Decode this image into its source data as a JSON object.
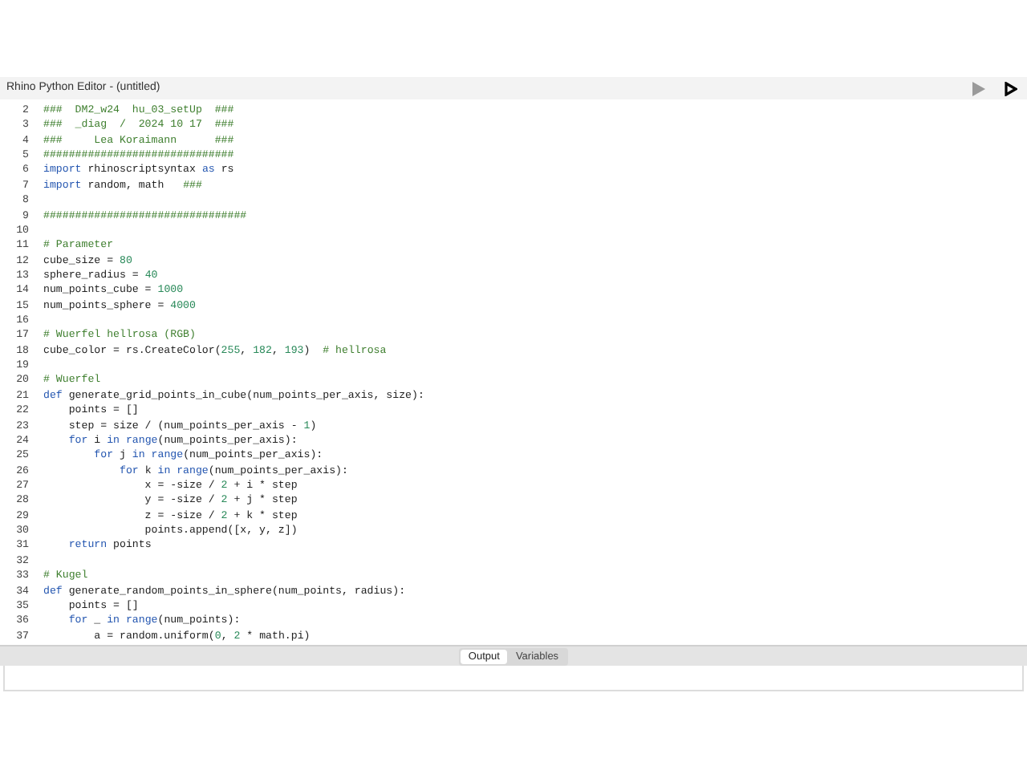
{
  "window": {
    "title": "Rhino Python Editor - (untitled)"
  },
  "editor": {
    "lines": [
      {
        "number": "2",
        "tokens": [
          {
            "kind": "comment",
            "text": "###  DM2_w24  hu_03_setUp  ###"
          }
        ]
      },
      {
        "number": "3",
        "tokens": [
          {
            "kind": "comment",
            "text": "###  _diag  /  2024 10 17  ###"
          }
        ]
      },
      {
        "number": "4",
        "tokens": [
          {
            "kind": "comment",
            "text": "###     Lea Koraimann      ###"
          }
        ]
      },
      {
        "number": "5",
        "tokens": [
          {
            "kind": "comment",
            "text": "##############################"
          }
        ]
      },
      {
        "number": "6",
        "tokens": [
          {
            "kind": "keyword",
            "text": "import"
          },
          {
            "kind": "plain",
            "text": " rhinoscriptsyntax "
          },
          {
            "kind": "keyword",
            "text": "as"
          },
          {
            "kind": "plain",
            "text": " rs"
          }
        ]
      },
      {
        "number": "7",
        "tokens": [
          {
            "kind": "keyword",
            "text": "import"
          },
          {
            "kind": "plain",
            "text": " random, math   "
          },
          {
            "kind": "comment",
            "text": "###"
          }
        ]
      },
      {
        "number": "8"
      },
      {
        "number": "9",
        "tokens": [
          {
            "kind": "comment",
            "text": "################################"
          }
        ]
      },
      {
        "number": "10"
      },
      {
        "number": "11",
        "tokens": [
          {
            "kind": "comment",
            "text": "# Parameter"
          }
        ]
      },
      {
        "number": "12",
        "tokens": [
          {
            "kind": "plain",
            "text": "cube_size = "
          },
          {
            "kind": "number",
            "text": "80"
          }
        ]
      },
      {
        "number": "13",
        "tokens": [
          {
            "kind": "plain",
            "text": "sphere_radius = "
          },
          {
            "kind": "number",
            "text": "40"
          }
        ]
      },
      {
        "number": "14",
        "tokens": [
          {
            "kind": "plain",
            "text": "num_points_cube = "
          },
          {
            "kind": "number",
            "text": "1000"
          }
        ]
      },
      {
        "number": "15",
        "tokens": [
          {
            "kind": "plain",
            "text": "num_points_sphere = "
          },
          {
            "kind": "number",
            "text": "4000"
          }
        ]
      },
      {
        "number": "16"
      },
      {
        "number": "17",
        "tokens": [
          {
            "kind": "comment",
            "text": "# Wuerfel hellrosa (RGB)"
          }
        ]
      },
      {
        "number": "18",
        "tokens": [
          {
            "kind": "plain",
            "text": "cube_color = rs.CreateColor("
          },
          {
            "kind": "number",
            "text": "255"
          },
          {
            "kind": "plain",
            "text": ", "
          },
          {
            "kind": "number",
            "text": "182"
          },
          {
            "kind": "plain",
            "text": ", "
          },
          {
            "kind": "number",
            "text": "193"
          },
          {
            "kind": "plain",
            "text": ")  "
          },
          {
            "kind": "comment",
            "text": "# hellrosa"
          }
        ]
      },
      {
        "number": "19"
      },
      {
        "number": "20",
        "tokens": [
          {
            "kind": "comment",
            "text": "# Wuerfel"
          }
        ]
      },
      {
        "number": "21",
        "tokens": [
          {
            "kind": "keyword",
            "text": "def"
          },
          {
            "kind": "plain",
            "text": " generate_grid_points_in_cube(num_points_per_axis, size):"
          }
        ]
      },
      {
        "number": "22",
        "tokens": [
          {
            "kind": "plain",
            "text": "    points = []"
          }
        ]
      },
      {
        "number": "23",
        "tokens": [
          {
            "kind": "plain",
            "text": "    step = size / (num_points_per_axis - "
          },
          {
            "kind": "number",
            "text": "1"
          },
          {
            "kind": "plain",
            "text": ")"
          }
        ]
      },
      {
        "number": "24",
        "tokens": [
          {
            "kind": "keyword",
            "text": "    for"
          },
          {
            "kind": "plain",
            "text": " i "
          },
          {
            "kind": "keyword",
            "text": "in range"
          },
          {
            "kind": "plain",
            "text": "(num_points_per_axis):"
          }
        ]
      },
      {
        "number": "25",
        "tokens": [
          {
            "kind": "keyword",
            "text": "        for"
          },
          {
            "kind": "plain",
            "text": " j "
          },
          {
            "kind": "keyword",
            "text": "in range"
          },
          {
            "kind": "plain",
            "text": "(num_points_per_axis):"
          }
        ]
      },
      {
        "number": "26",
        "tokens": [
          {
            "kind": "keyword",
            "text": "            for"
          },
          {
            "kind": "plain",
            "text": " k "
          },
          {
            "kind": "keyword",
            "text": "in range"
          },
          {
            "kind": "plain",
            "text": "(num_points_per_axis):"
          }
        ]
      },
      {
        "number": "27",
        "tokens": [
          {
            "kind": "plain",
            "text": "                x = -size / "
          },
          {
            "kind": "number",
            "text": "2"
          },
          {
            "kind": "plain",
            "text": " + i * step"
          }
        ]
      },
      {
        "number": "28",
        "tokens": [
          {
            "kind": "plain",
            "text": "                y = -size / "
          },
          {
            "kind": "number",
            "text": "2"
          },
          {
            "kind": "plain",
            "text": " + j * step"
          }
        ]
      },
      {
        "number": "29",
        "tokens": [
          {
            "kind": "plain",
            "text": "                z = -size / "
          },
          {
            "kind": "number",
            "text": "2"
          },
          {
            "kind": "plain",
            "text": " + k * step"
          }
        ]
      },
      {
        "number": "30",
        "tokens": [
          {
            "kind": "plain",
            "text": "                points.append([x, y, z])"
          }
        ]
      },
      {
        "number": "31",
        "tokens": [
          {
            "kind": "keyword",
            "text": "    return"
          },
          {
            "kind": "plain",
            "text": " points"
          }
        ]
      },
      {
        "number": "32"
      },
      {
        "number": "33",
        "tokens": [
          {
            "kind": "comment",
            "text": "# Kugel"
          }
        ]
      },
      {
        "number": "34",
        "tokens": [
          {
            "kind": "keyword",
            "text": "def"
          },
          {
            "kind": "plain",
            "text": " generate_random_points_in_sphere(num_points, radius):"
          }
        ]
      },
      {
        "number": "35",
        "tokens": [
          {
            "kind": "plain",
            "text": "    points = []"
          }
        ]
      },
      {
        "number": "36",
        "tokens": [
          {
            "kind": "keyword",
            "text": "    for"
          },
          {
            "kind": "plain",
            "text": " _ "
          },
          {
            "kind": "keyword",
            "text": "in range"
          },
          {
            "kind": "plain",
            "text": "(num_points):"
          }
        ]
      },
      {
        "number": "37",
        "tokens": [
          {
            "kind": "plain",
            "text": "        a = random.uniform("
          },
          {
            "kind": "number",
            "text": "0"
          },
          {
            "kind": "plain",
            "text": ", "
          },
          {
            "kind": "number",
            "text": "2"
          },
          {
            "kind": "plain",
            "text": " * math.pi)"
          }
        ]
      }
    ]
  },
  "bottom_tabs": [
    {
      "label": "Output",
      "selected": true
    },
    {
      "label": "Variables",
      "selected": false
    }
  ]
}
